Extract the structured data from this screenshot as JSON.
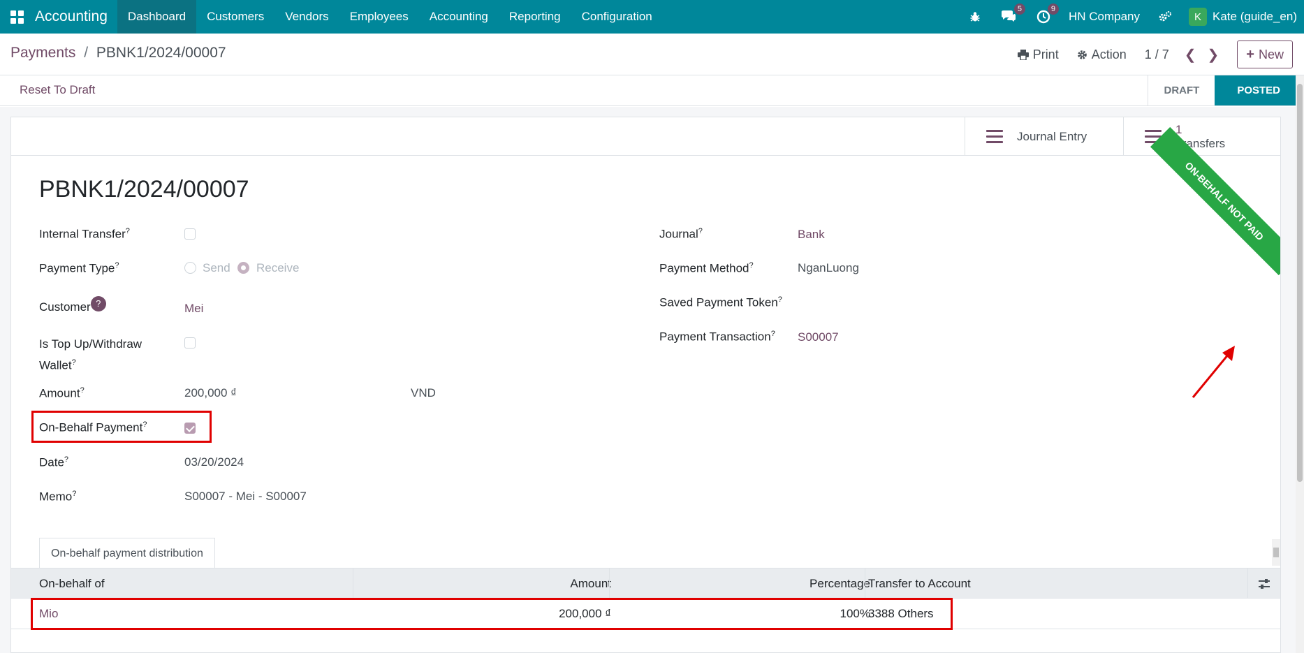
{
  "navbar": {
    "brand": "Accounting",
    "menu": [
      "Dashboard",
      "Customers",
      "Vendors",
      "Employees",
      "Accounting",
      "Reporting",
      "Configuration"
    ],
    "messages_count": "5",
    "activities_count": "9",
    "company": "HN Company",
    "user_initial": "K",
    "user_name": "Kate (guide_en)"
  },
  "breadcrumb": {
    "parent": "Payments",
    "separator": "/",
    "current": "PBNK1/2024/00007"
  },
  "control": {
    "print_label": "Print",
    "action_label": "Action",
    "pager": "1 / 7",
    "new_label": "New"
  },
  "statusbar": {
    "reset_label": "Reset To Draft",
    "stages": [
      "DRAFT",
      "POSTED"
    ],
    "active_stage": "POSTED"
  },
  "smart_buttons": {
    "journal_entry_label": "Journal Entry",
    "transfers_count": "1",
    "transfers_label": "Transfers"
  },
  "ribbon": "ON-BEHALF NOT PAID",
  "record": {
    "title": "PBNK1/2024/00007",
    "left_fields": {
      "internal_transfer_label": "Internal Transfer",
      "payment_type_label": "Payment Type",
      "payment_type_send": "Send",
      "payment_type_receive": "Receive",
      "customer_label": "Customer",
      "customer_value": "Mei",
      "topup_label_1": "Is Top Up/Withdraw",
      "topup_label_2": "Wallet",
      "amount_label": "Amount",
      "amount_value": "200,000 ₫",
      "currency_value": "VND",
      "onbehalf_label": "On-Behalf Payment",
      "date_label": "Date",
      "date_value": "03/20/2024",
      "memo_label": "Memo",
      "memo_value": "S00007 - Mei - S00007"
    },
    "right_fields": {
      "journal_label": "Journal",
      "journal_value": "Bank",
      "payment_method_label": "Payment Method",
      "payment_method_value": "NganLuong",
      "saved_token_label": "Saved Payment Token",
      "transaction_label": "Payment Transaction",
      "transaction_value": "S00007"
    },
    "help_mark": "?"
  },
  "notebook": {
    "tab_label": "On-behalf payment distribution",
    "columns": [
      "On-behalf of",
      "Amount",
      "Percentage",
      "Transfer to Account"
    ],
    "rows": [
      {
        "onbehalf_of": "Mio",
        "amount": "200,000 ₫",
        "percentage": "100%",
        "account": "3388 Others"
      }
    ]
  },
  "colors": {
    "navbar": "#00879a",
    "brand_purple": "#714b67",
    "ribbon_green": "#28a745",
    "highlight_red": "#e00000"
  }
}
